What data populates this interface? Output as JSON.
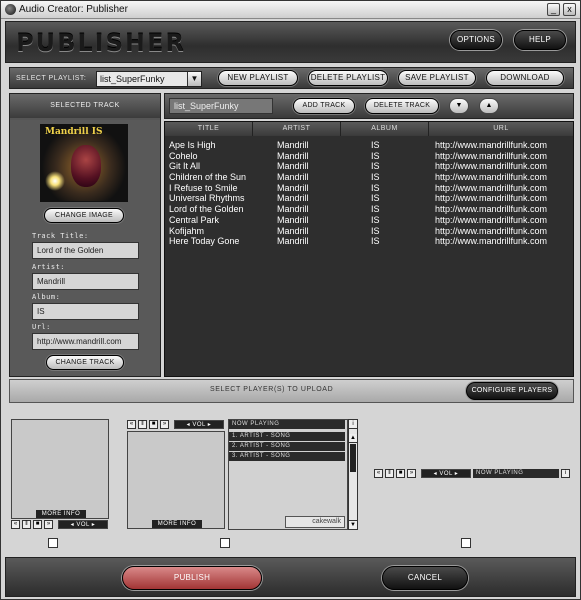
{
  "window": {
    "title": "Audio Creator: Publisher",
    "min_glyph": "_",
    "close_glyph": "x"
  },
  "header": {
    "logo": "PUBLISHER",
    "options": "OPTIONS",
    "help": "HELP"
  },
  "playlist_bar": {
    "label": "SELECT PLAYLIST:",
    "selected": "list_SuperFunky",
    "new": "NEW PLAYLIST",
    "delete": "DELETE PLAYLIST",
    "save": "SAVE PLAYLIST",
    "download": "DOWNLOAD"
  },
  "selected_track": {
    "heading": "SELECTED TRACK",
    "cover_text": "Mandrill IS",
    "change_image": "CHANGE IMAGE",
    "title_label": "Track Title:",
    "title": "Lord of the Golden",
    "artist_label": "Artist:",
    "artist": "Mandrill",
    "album_label": "Album:",
    "album": "IS",
    "url_label": "Url:",
    "url": "http://www.mandrill.com",
    "change_track": "CHANGE TRACK"
  },
  "tracks_bar": {
    "playlist_name": "list_SuperFunky",
    "add": "ADD TRACK",
    "delete": "DELETE TRACK",
    "down_glyph": "▼",
    "up_glyph": "▲"
  },
  "table": {
    "columns": [
      "TITLE",
      "ARTIST",
      "ALBUM",
      "URL"
    ],
    "rows": [
      [
        "Ape Is High",
        "Mandrill",
        "IS",
        "http://www.mandrillfunk.com"
      ],
      [
        "Cohelo",
        "Mandrill",
        "IS",
        "http://www.mandrillfunk.com"
      ],
      [
        "Git It All",
        "Mandrill",
        "IS",
        "http://www.mandrillfunk.com"
      ],
      [
        "Children of the Sun",
        "Mandrill",
        "IS",
        "http://www.mandrillfunk.com"
      ],
      [
        "I Refuse to Smile",
        "Mandrill",
        "IS",
        "http://www.mandrillfunk.com"
      ],
      [
        "Universal Rhythms",
        "Mandrill",
        "IS",
        "http://www.mandrillfunk.com"
      ],
      [
        "Lord of the Golden",
        "Mandrill",
        "IS",
        "http://www.mandrillfunk.com"
      ],
      [
        "Central Park",
        "Mandrill",
        "IS",
        "http://www.mandrillfunk.com"
      ],
      [
        "Kofijahm",
        "Mandrill",
        "IS",
        "http://www.mandrillfunk.com"
      ],
      [
        "Here Today Gone",
        "Mandrill",
        "IS",
        "http://www.mandrillfunk.com"
      ]
    ]
  },
  "upload": {
    "label": "SELECT PLAYER(S) TO UPLOAD",
    "configure": "CONFIGURE PLAYERS"
  },
  "players": {
    "more_info": "MORE INFO",
    "vol": "◂ VOL ▸",
    "now_playing": "NOW PLAYING",
    "songs": [
      "1. ARTIST - SONG",
      "2. ARTIST - SONG",
      "3. ARTIST - SONG"
    ],
    "brand": "cakewalk",
    "prev_glyph": "«",
    "pause_glyph": "‖",
    "stop_glyph": "■",
    "next_glyph": "»",
    "info_glyph": "i"
  },
  "footer": {
    "publish": "PUBLISH",
    "cancel": "CANCEL"
  }
}
